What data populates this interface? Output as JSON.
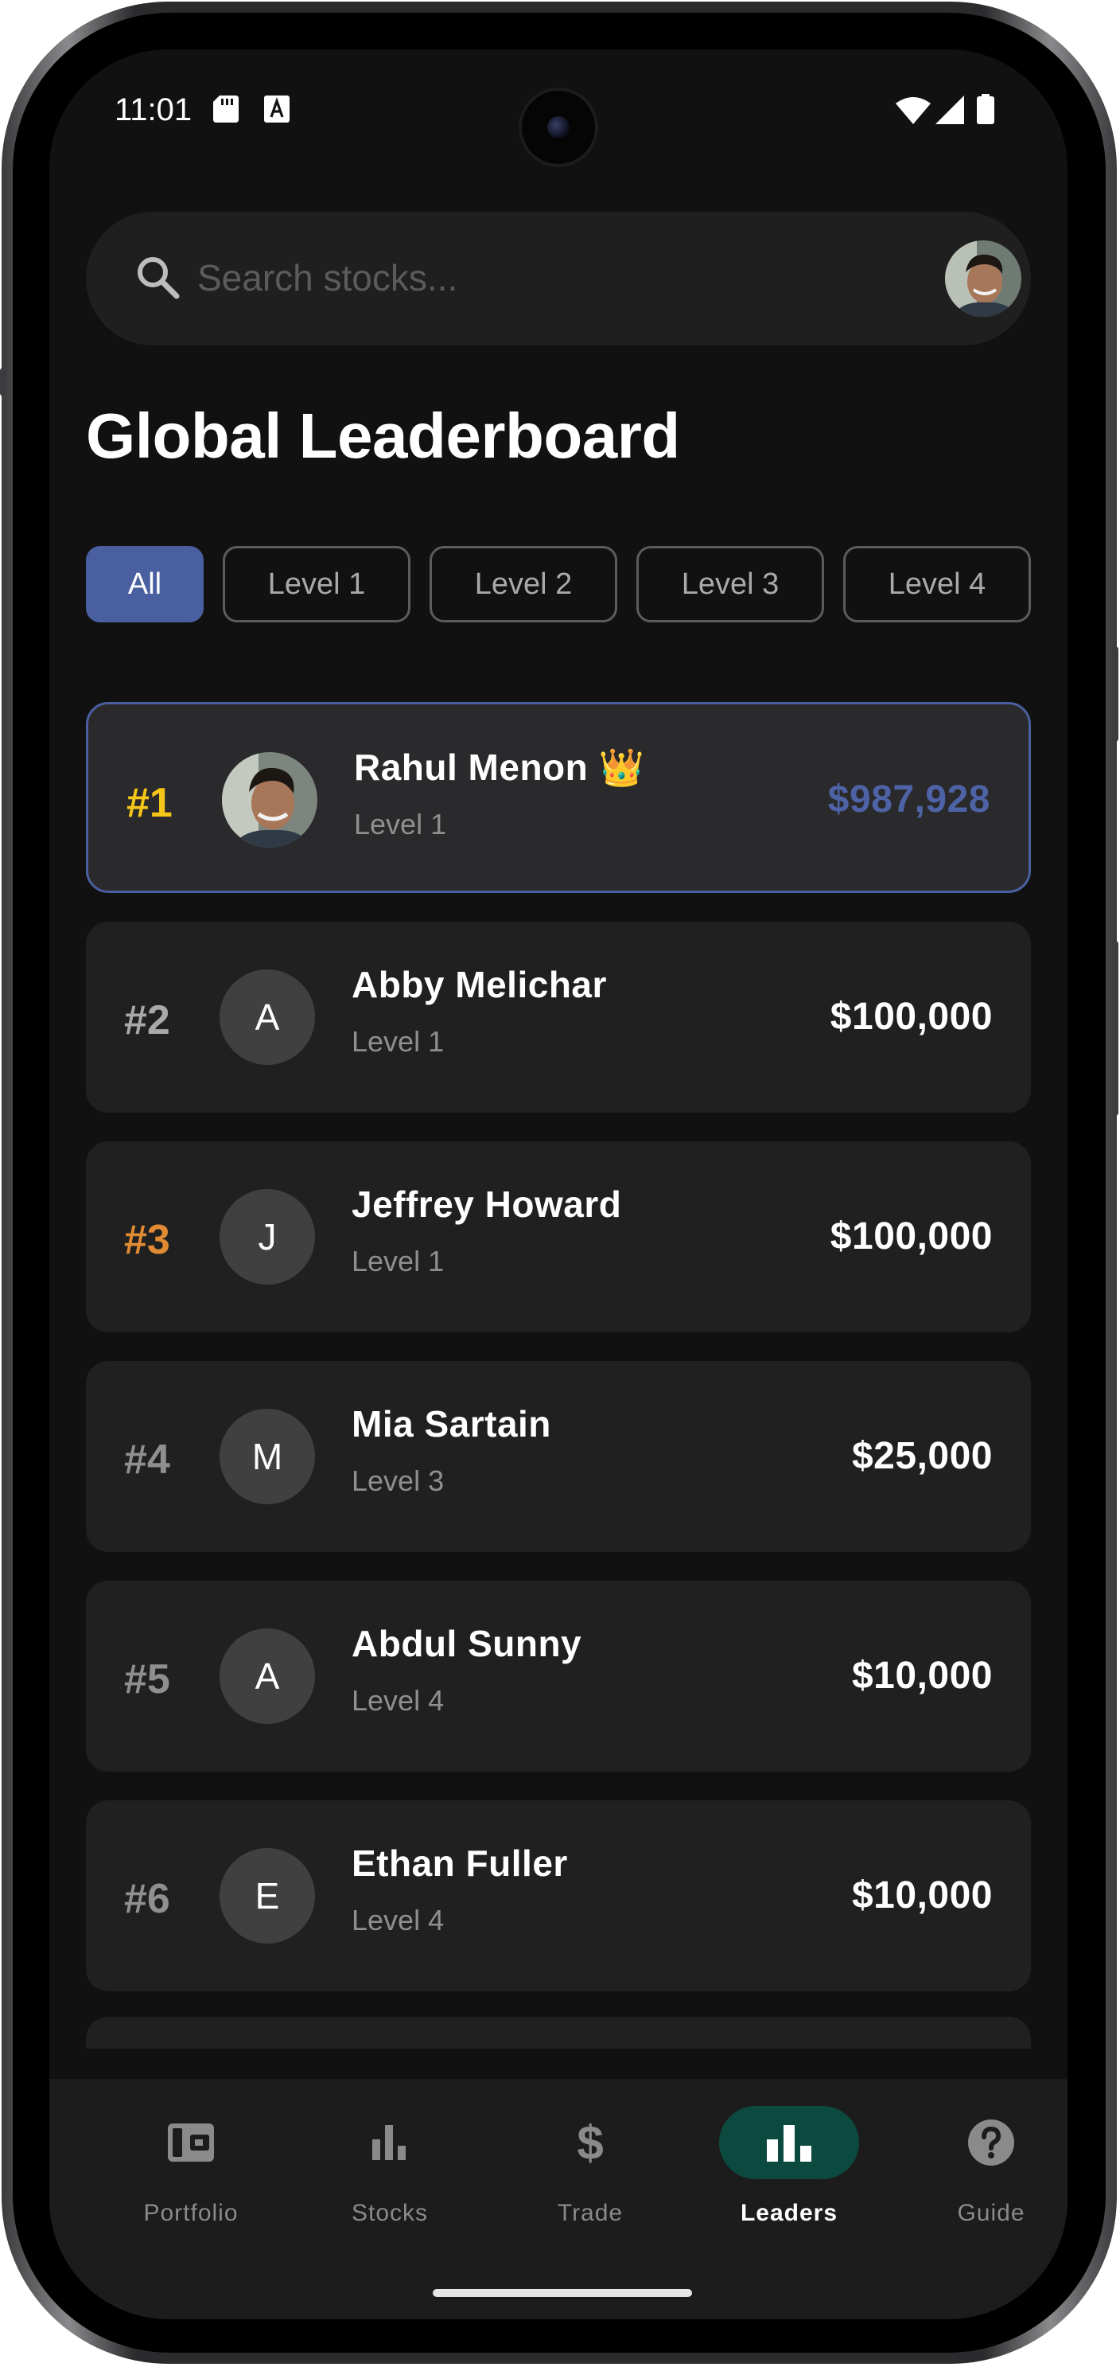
{
  "status_bar": {
    "time": "11:01"
  },
  "search": {
    "placeholder": "Search stocks..."
  },
  "page_title": "Global Leaderboard",
  "filters": [
    {
      "label": "All",
      "active": true
    },
    {
      "label": "Level 1",
      "active": false
    },
    {
      "label": "Level 2",
      "active": false
    },
    {
      "label": "Level 3",
      "active": false
    },
    {
      "label": "Level 4",
      "active": false
    }
  ],
  "leaderboard": [
    {
      "rank": "#1",
      "name": "Rahul Menon",
      "badge": "👑",
      "level": "Level 1",
      "value": "$987,928",
      "initial": "",
      "rank_color": "#f5c518",
      "highlighted": true
    },
    {
      "rank": "#2",
      "name": "Abby Melichar",
      "level": "Level 1",
      "value": "$100,000",
      "initial": "A",
      "rank_color": "#a8a8a8"
    },
    {
      "rank": "#3",
      "name": "Jeffrey Howard",
      "level": "Level 1",
      "value": "$100,000",
      "initial": "J",
      "rank_color": "#e08a34"
    },
    {
      "rank": "#4",
      "name": "Mia Sartain",
      "level": "Level 3",
      "value": "$25,000",
      "initial": "M",
      "rank_color": "#8f8f8f"
    },
    {
      "rank": "#5",
      "name": "Abdul Sunny",
      "level": "Level 4",
      "value": "$10,000",
      "initial": "A",
      "rank_color": "#8f8f8f"
    },
    {
      "rank": "#6",
      "name": "Ethan Fuller",
      "level": "Level 4",
      "value": "$10,000",
      "initial": "E",
      "rank_color": "#8f8f8f"
    }
  ],
  "nav": [
    {
      "label": "Portfolio",
      "icon": "wallet-icon",
      "active": false
    },
    {
      "label": "Stocks",
      "icon": "bar-chart-icon",
      "active": false
    },
    {
      "label": "Trade",
      "icon": "dollar-icon",
      "active": false
    },
    {
      "label": "Leaders",
      "icon": "leaderboard-icon",
      "active": true
    },
    {
      "label": "Guide",
      "icon": "help-icon",
      "active": false
    }
  ],
  "colors": {
    "accent": "#4a5f9f",
    "nav_active": "#0c4a40",
    "gold": "#f5c518",
    "bronze": "#e08a34",
    "background": "#111111"
  }
}
